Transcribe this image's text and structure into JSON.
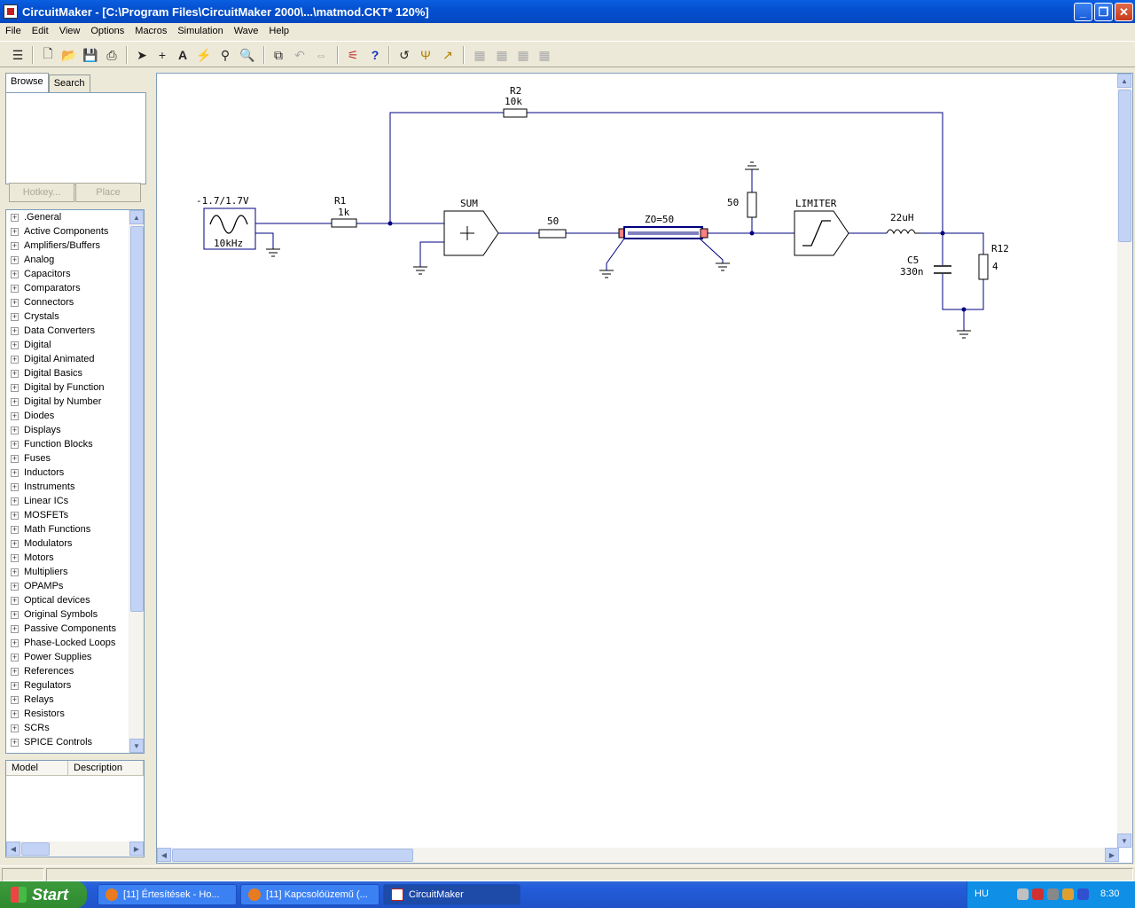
{
  "window": {
    "title": "CircuitMaker - [C:\\Program Files\\CircuitMaker 2000\\...\\matmod.CKT* 120%]"
  },
  "menu": [
    "File",
    "Edit",
    "View",
    "Options",
    "Macros",
    "Simulation",
    "Wave",
    "Help"
  ],
  "toolbar_icons": [
    "menu-toggle-icon",
    "new-file-icon",
    "open-folder-icon",
    "save-disk-icon",
    "print-icon",
    "arrow-pointer-icon",
    "wire-cross-icon",
    "text-tool-icon",
    "probe-lightning-icon",
    "zoom-probe-icon",
    "magnifier-icon",
    "zoom-window-icon",
    "rotate-icon",
    "mirror-icon",
    "digital-sim-icon",
    "help-question-icon",
    "undo-icon",
    "run-icon",
    "trace-icon",
    "grid-1-icon",
    "grid-2-icon",
    "grid-3-icon",
    "grid-4-icon"
  ],
  "sidebar": {
    "tabs": [
      "Browse",
      "Search"
    ],
    "hotkey_button": "Hotkey...",
    "place_button": "Place",
    "categories": [
      ".General",
      "Active Components",
      "Amplifiers/Buffers",
      "Analog",
      "Capacitors",
      "Comparators",
      "Connectors",
      "Crystals",
      "Data Converters",
      "Digital",
      "Digital Animated",
      "Digital Basics",
      "Digital by Function",
      "Digital by Number",
      "Diodes",
      "Displays",
      "Function Blocks",
      "Fuses",
      "Inductors",
      "Instruments",
      "Linear ICs",
      "MOSFETs",
      "Math Functions",
      "Modulators",
      "Motors",
      "Multipliers",
      "OPAMPs",
      "Optical devices",
      "Original Symbols",
      "Passive Components",
      "Phase-Locked Loops",
      "Power Supplies",
      "References",
      "Regulators",
      "Relays",
      "Resistors",
      "SCRs",
      "SPICE Controls"
    ],
    "model_columns": [
      "Model",
      "Description"
    ]
  },
  "schematic": {
    "source_amp": "-1.7/1.7V",
    "source_freq": "10kHz",
    "r1_name": "R1",
    "r1_value": "1k",
    "r2_name": "R2",
    "r2_value": "10k",
    "sum_label": "SUM",
    "r_series_value": "50",
    "tline_label": "ZO=50",
    "r_shunt_value": "50",
    "limiter_label": "LIMITER",
    "inductor_value": "22uH",
    "c5_name": "C5",
    "c5_value": "330n",
    "r12_name": "R12",
    "r12_value": "4"
  },
  "taskbar": {
    "start": "Start",
    "tasks": [
      "[11] Értesítések - Ho...",
      "[11] Kapcsolóüzemű (...",
      "CircuitMaker"
    ],
    "lang": "HU",
    "time": "8:30"
  }
}
